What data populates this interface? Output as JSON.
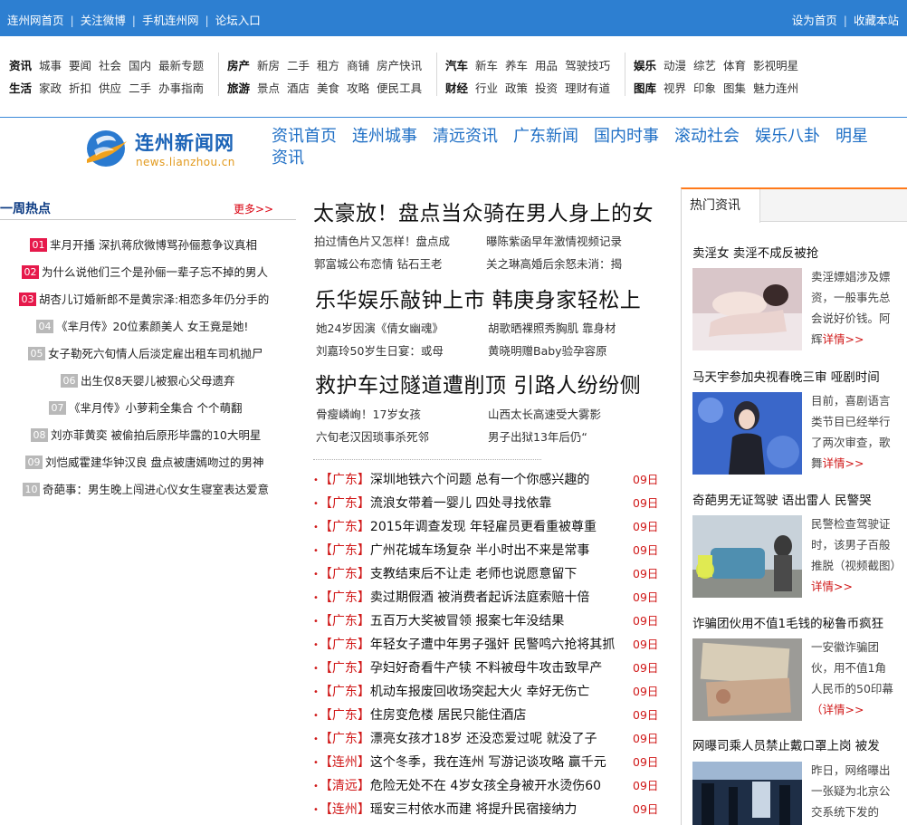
{
  "topbar": {
    "left_links": [
      "连州网首页",
      "关注微博",
      "手机连州网",
      "论坛入口"
    ],
    "right_links": [
      "设为首页",
      "收藏本站"
    ]
  },
  "channels": [
    {
      "rows": [
        {
          "head": "资讯",
          "links": [
            "城事",
            "要闻",
            "社会",
            "国内",
            "最新专题"
          ]
        },
        {
          "head": "生活",
          "links": [
            "家政",
            "折扣",
            "供应",
            "二手",
            "办事指南"
          ]
        }
      ]
    },
    {
      "rows": [
        {
          "head": "房产",
          "links": [
            "新房",
            "二手",
            "租方",
            "商铺",
            "房产快讯"
          ]
        },
        {
          "head": "旅游",
          "links": [
            "景点",
            "酒店",
            "美食",
            "攻略",
            "便民工具"
          ]
        }
      ]
    },
    {
      "rows": [
        {
          "head": "汽车",
          "links": [
            "新车",
            "养车",
            "用品",
            "驾驶技巧"
          ]
        },
        {
          "head": "财经",
          "links": [
            "行业",
            "政策",
            "投资",
            "理财有道"
          ]
        }
      ]
    },
    {
      "rows": [
        {
          "head": "娱乐",
          "links": [
            "动漫",
            "综艺",
            "体育",
            "影视明星"
          ]
        },
        {
          "head": "图库",
          "links": [
            "视界",
            "印象",
            "图集",
            "魅力连州"
          ]
        }
      ]
    }
  ],
  "logo": {
    "name": "连州新闻网",
    "url": "news.lianzhou.cn"
  },
  "mainnav": [
    "资讯首页",
    "连州城事",
    "清远资讯",
    "广东新闻",
    "国内时事",
    "滚动社会",
    "娱乐八卦",
    "明星",
    "资讯"
  ],
  "weekly": {
    "title": "一周热点",
    "more": "更多>>",
    "items": [
      {
        "num": "01",
        "text": "芈月开播  深扒蒋欣微博骂孙俪惹争议真相"
      },
      {
        "num": "02",
        "text": "为什么说他们三个是孙俪一辈子忘不掉的男人"
      },
      {
        "num": "03",
        "text": "胡杏儿订婚新郎不是黄宗泽:相恋多年仍分手的"
      },
      {
        "num": "04",
        "text": "《芈月传》20位素颜美人  女王竟是她!"
      },
      {
        "num": "05",
        "text": "女子勒死六旬情人后淡定雇出租车司机抛尸"
      },
      {
        "num": "06",
        "text": "出生仅8天婴儿被狠心父母遗弃"
      },
      {
        "num": "07",
        "text": "《芈月传》小萝莉全集合  个个萌翻"
      },
      {
        "num": "08",
        "text": "刘亦菲黄奕  被偷拍后原形毕露的10大明星"
      },
      {
        "num": "09",
        "text": "刘恺威霍建华钟汉良  盘点被唐嫣吻过的男神"
      },
      {
        "num": "10",
        "text": "奇葩事：男生晚上闯进心仪女生寝室表达爱意"
      }
    ]
  },
  "headlines": [
    {
      "title": "太豪放！盘点当众骑在男人身上的女",
      "subs": [
        "拍过情色片又怎样！盘点成",
        "曝陈紫函早年激情视频记录",
        "郭富城公布恋情  钻石王老",
        "关之琳高婚后余怒未消：揭"
      ]
    },
    {
      "title": "乐华娱乐敲钟上市  韩庚身家轻松上",
      "subs": [
        "她24岁因演《倩女幽魂》",
        "胡歌晒裸照秀胸肌  靠身材",
        "刘嘉玲50岁生日宴：或母",
        "黄晓明赠Baby验孕容原"
      ]
    },
    {
      "title": "救护车过隧道遭削顶  引路人纷纷侧",
      "subs": [
        "骨瘦嶙峋！17岁女孩",
        "山西太长高速受大雾影",
        "六旬老汉因琐事杀死邻",
        "男子出狱13年后仍“"
      ]
    }
  ],
  "news": [
    {
      "tag": "【广东】",
      "title": "深圳地铁六个问题  总有一个你感兴趣的",
      "date": "09日"
    },
    {
      "tag": "【广东】",
      "title": "流浪女带着一婴儿  四处寻找依靠",
      "date": "09日"
    },
    {
      "tag": "【广东】",
      "title": "2015年调查发现  年轻雇员更看重被尊重",
      "date": "09日"
    },
    {
      "tag": "【广东】",
      "title": "广州花城车场复杂  半小时出不来是常事",
      "date": "09日"
    },
    {
      "tag": "【广东】",
      "title": "支教结束后不让走  老师也说愿意留下",
      "date": "09日"
    },
    {
      "tag": "【广东】",
      "title": "卖过期假酒  被消费者起诉法庭索赔十倍",
      "date": "09日"
    },
    {
      "tag": "【广东】",
      "title": "五百万大奖被冒领  报案七年没结果",
      "date": "09日"
    },
    {
      "tag": "【广东】",
      "title": "年轻女子遭中年男子强奸  民警鸣六抢将其抓",
      "date": "09日"
    },
    {
      "tag": "【广东】",
      "title": "孕妇好奇看牛产犊  不料被母牛攻击致早产",
      "date": "09日"
    },
    {
      "tag": "【广东】",
      "title": "机动车报废回收场突起大火  幸好无伤亡",
      "date": "09日"
    },
    {
      "tag": "【广东】",
      "title": "住房变危楼  居民只能住酒店",
      "date": "09日"
    },
    {
      "tag": "【广东】",
      "title": "漂亮女孩才18岁  还没恋爱过呢  就没了子",
      "date": "09日"
    },
    {
      "tag": "【连州】",
      "title": "这个冬季，我在连州  写游记谈攻略  赢千元",
      "date": "09日"
    },
    {
      "tag": "【清远】",
      "title": "危险无处不在  4岁女孩全身被开水烫伤60",
      "date": "09日"
    },
    {
      "tag": "【连州】",
      "title": "瑶安三村依水而建  将提升民宿接纳力",
      "date": "09日"
    }
  ],
  "hot": {
    "tab": "热门资讯",
    "items": [
      {
        "title": "卖淫女  卖淫不成反被抢",
        "desc": "卖淫嫖娼涉及嫖资，一般事先总会说好价钱。阿辉",
        "more": "详情>>"
      },
      {
        "title": "马天宇参加央视春晚三审  哑剧时间",
        "desc": "目前，喜剧语言类节目已经举行了两次审查，歌舞",
        "more": "详情>>"
      },
      {
        "title": "奇葩男无证驾驶  语出雷人  民警哭",
        "desc": "民警检查驾驶证时，该男子百般推脱（视频截图）",
        "more": "详情>>"
      },
      {
        "title": "诈骗团伙用不值1毛钱的秘鲁币疯狂",
        "desc": "一安徽诈骗团伙，用不值1角人民币的50印幕",
        "more": "（详情>>"
      },
      {
        "title": "网曝司乘人员禁止戴口罩上岗  被发",
        "desc": "昨日，网络曝出一张疑为北京公交系统下发的",
        "more": ""
      }
    ]
  }
}
